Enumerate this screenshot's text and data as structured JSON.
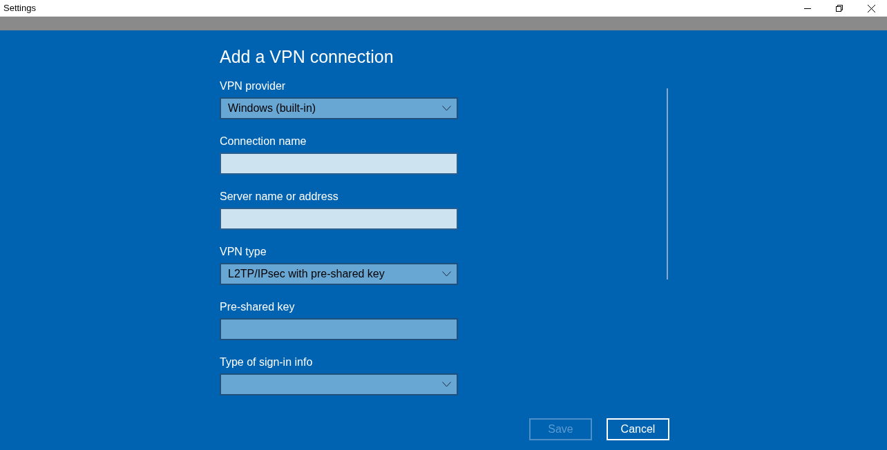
{
  "window": {
    "title": "Settings"
  },
  "page": {
    "title": "Add a VPN connection"
  },
  "fields": [
    {
      "kind": "dropdown",
      "label": "VPN provider",
      "value": "Windows (built-in)"
    },
    {
      "kind": "text",
      "label": "Connection name"
    },
    {
      "kind": "text",
      "label": "Server name or address"
    },
    {
      "kind": "dropdown",
      "label": "VPN type",
      "value": "L2TP/IPsec with pre-shared key"
    },
    {
      "kind": "password",
      "label": "Pre-shared key"
    },
    {
      "kind": "dropdown",
      "label": "Type of sign-in info"
    }
  ],
  "buttons": [
    {
      "label": "Save",
      "disabled": true
    },
    {
      "label": "Cancel",
      "disabled": false
    }
  ]
}
